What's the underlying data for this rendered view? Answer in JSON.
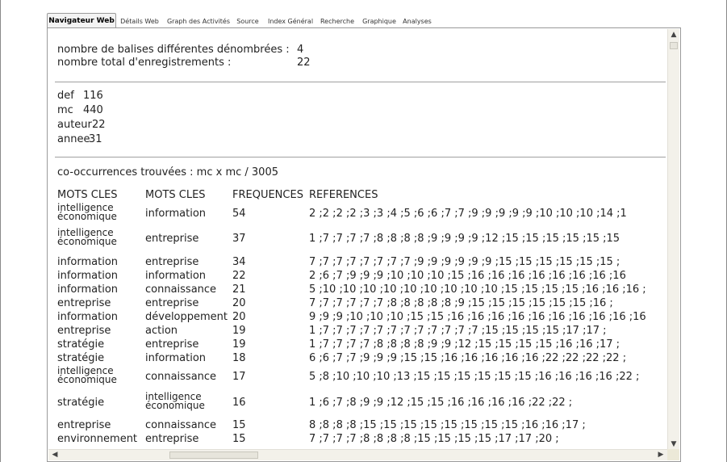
{
  "tabs": [
    {
      "label": "Navigateur Web",
      "active": true
    },
    {
      "label": "Détails Web",
      "active": false
    },
    {
      "label": "Graph des Activités",
      "active": false
    },
    {
      "label": "Source",
      "active": false
    },
    {
      "label": "Index Général",
      "active": false
    },
    {
      "label": "Recherche",
      "active": false
    },
    {
      "label": "Graphique",
      "active": false
    },
    {
      "label": "Analyses",
      "active": false
    }
  ],
  "summary": {
    "line1_label": "nombre de balises différentes dénombrées :",
    "line1_value": "4",
    "line2_label": "nombre total d'enregistrements :",
    "line2_value": "22"
  },
  "tags": [
    {
      "name": "def",
      "count": "116"
    },
    {
      "name": "mc",
      "count": "440"
    },
    {
      "name": "auteur",
      "count": "22"
    },
    {
      "name": "annee",
      "count": "31"
    }
  ],
  "cooccurrence": {
    "title": "co-occurrences trouvées : mc x mc / 3005",
    "headers": [
      "MOTS CLES",
      "MOTS CLES",
      "FREQUENCES",
      "REFERENCES"
    ],
    "rows": [
      {
        "a": "intelligence économique",
        "b": "information",
        "f": "54",
        "r": "2 ;2 ;2 ;2 ;3 ;3 ;4 ;5 ;6 ;6 ;7 ;7 ;9 ;9 ;9 ;9 ;9 ;10 ;10 ;10 ;14 ;1"
      },
      {
        "a": "intelligence économique",
        "b": "entreprise",
        "f": "37",
        "r": "1 ;7 ;7 ;7 ;7 ;8 ;8 ;8 ;8 ;9 ;9 ;9 ;9 ;12 ;15 ;15 ;15 ;15 ;15 ;15"
      },
      {
        "a": "information",
        "b": "entreprise",
        "f": "34",
        "r": "7 ;7 ;7 ;7 ;7 ;7 ;7 ;7 ;9 ;9 ;9 ;9 ;9 ;9 ;15 ;15 ;15 ;15 ;15 ;15 ;"
      },
      {
        "a": "information",
        "b": "information",
        "f": "22",
        "r": "2 ;6 ;7 ;9 ;9 ;9 ;10 ;10 ;10 ;15 ;16 ;16 ;16 ;16 ;16 ;16 ;16 ;16"
      },
      {
        "a": "information",
        "b": "connaissance",
        "f": "21",
        "r": "5 ;10 ;10 ;10 ;10 ;10 ;10 ;10 ;10 ;10 ;15 ;15 ;15 ;15 ;16 ;16 ;16 ;"
      },
      {
        "a": "entreprise",
        "b": "entreprise",
        "f": "20",
        "r": "7 ;7 ;7 ;7 ;7 ;7 ;8 ;8 ;8 ;8 ;8 ;9 ;15 ;15 ;15 ;15 ;15 ;15 ;16 ;"
      },
      {
        "a": "information",
        "b": "développement",
        "f": "20",
        "r": "9 ;9 ;9 ;10 ;10 ;10 ;15 ;15 ;16 ;16 ;16 ;16 ;16 ;16 ;16 ;16 ;16 ;16"
      },
      {
        "a": "entreprise",
        "b": "action",
        "f": "19",
        "r": "1 ;7 ;7 ;7 ;7 ;7 ;7 ;7 ;7 ;7 ;7 ;7 ;7 ;15 ;15 ;15 ;15 ;17 ;17 ;"
      },
      {
        "a": "stratégie",
        "b": "entreprise",
        "f": "19",
        "r": "1 ;7 ;7 ;7 ;7 ;8 ;8 ;8 ;8 ;9 ;9 ;12 ;15 ;15 ;15 ;15 ;16 ;16 ;17 ;"
      },
      {
        "a": "stratégie",
        "b": "information",
        "f": "18",
        "r": "6 ;6 ;7 ;7 ;9 ;9 ;9 ;15 ;15 ;16 ;16 ;16 ;16 ;16 ;22 ;22 ;22 ;22 ;"
      },
      {
        "a": "intelligence économique",
        "b": "connaissance",
        "f": "17",
        "r": "5 ;8 ;10 ;10 ;10 ;13 ;15 ;15 ;15 ;15 ;15 ;15 ;16 ;16 ;16 ;16 ;22 ;"
      },
      {
        "a": "stratégie",
        "b": "intelligence économique",
        "f": "16",
        "r": "1 ;6 ;7 ;8 ;9 ;9 ;12 ;15 ;15 ;16 ;16 ;16 ;16 ;22 ;22 ;"
      },
      {
        "a": "entreprise",
        "b": "connaissance",
        "f": "15",
        "r": "8 ;8 ;8 ;8 ;15 ;15 ;15 ;15 ;15 ;15 ;15 ;15 ;16 ;16 ;17 ;"
      },
      {
        "a": "environnement",
        "b": "entreprise",
        "f": "15",
        "r": "7 ;7 ;7 ;7 ;8 ;8 ;8 ;8 ;15 ;15 ;15 ;15 ;17 ;17 ;20 ;"
      }
    ]
  },
  "icons": {
    "scroll_up": "scroll-up-arrow-icon",
    "scroll_down": "scroll-down-arrow-icon",
    "scroll_left": "scroll-left-arrow-icon",
    "scroll_right": "scroll-right-arrow-icon"
  }
}
